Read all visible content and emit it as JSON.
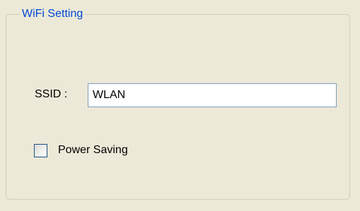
{
  "groupbox": {
    "title": "WiFi Setting"
  },
  "ssid": {
    "label": "SSID :",
    "value": "WLAN"
  },
  "power_saving": {
    "label": "Power Saving",
    "checked": false
  },
  "colors": {
    "background": "#ECE9D8",
    "group_title": "#0046D5",
    "input_border": "#7F9DB9",
    "checkbox_border": "#1C5180"
  }
}
